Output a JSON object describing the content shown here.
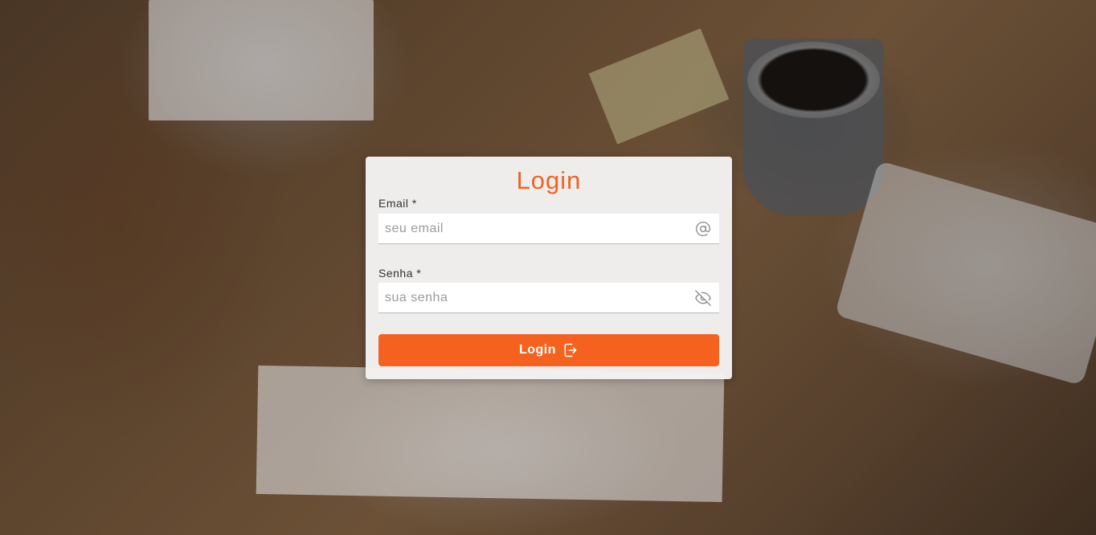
{
  "login_form": {
    "title": "Login",
    "email": {
      "label": "Email *",
      "placeholder": "seu email",
      "icon": "at-sign-icon"
    },
    "password": {
      "label": "Senha *",
      "placeholder": "sua senha",
      "icon": "eye-off-icon"
    },
    "submit": {
      "label": "Login",
      "icon": "sign-in-icon"
    }
  },
  "colors": {
    "accent": "#f5621f",
    "card_background": "#f4f3f2"
  }
}
